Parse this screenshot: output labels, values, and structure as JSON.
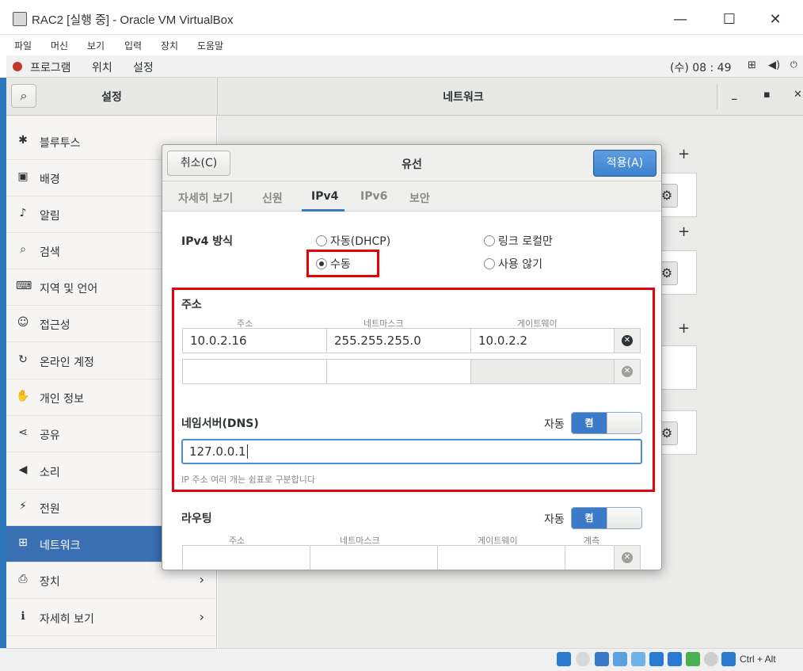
{
  "vbox": {
    "title": "RAC2 [실행 중] - Oracle VM VirtualBox",
    "menu": [
      "파일",
      "머신",
      "보기",
      "입력",
      "장치",
      "도움말"
    ],
    "host_key": "Ctrl + Alt"
  },
  "guest_topbar": {
    "apps": "프로그램",
    "places": "위치",
    "settings": "설정",
    "clock": "(수) 08 : 49"
  },
  "settings": {
    "title": "설정",
    "panel_title": "네트워크",
    "sidebar": [
      {
        "label": "블루투스",
        "icon": "bluetooth-icon",
        "glyph": "✱"
      },
      {
        "label": "배경",
        "icon": "background-icon",
        "glyph": "▣"
      },
      {
        "label": "알림",
        "icon": "bell-icon",
        "glyph": "♪"
      },
      {
        "label": "검색",
        "icon": "search-icon",
        "glyph": "⌕"
      },
      {
        "label": "지역 및 언어",
        "icon": "region-icon",
        "glyph": "⌨"
      },
      {
        "label": "접근성",
        "icon": "accessibility-icon",
        "glyph": "☺"
      },
      {
        "label": "온라인 계정",
        "icon": "online-accounts-icon",
        "glyph": "↻"
      },
      {
        "label": "개인 정보",
        "icon": "privacy-icon",
        "glyph": "✋"
      },
      {
        "label": "공유",
        "icon": "share-icon",
        "glyph": "⋖"
      },
      {
        "label": "소리",
        "icon": "sound-icon",
        "glyph": "◀"
      },
      {
        "label": "전원",
        "icon": "power-icon",
        "glyph": "⚡"
      },
      {
        "label": "네트워크",
        "icon": "network-icon",
        "glyph": "⊞"
      },
      {
        "label": "장치",
        "icon": "devices-icon",
        "glyph": "⎙"
      },
      {
        "label": "자세히 보기",
        "icon": "details-icon",
        "glyph": "ℹ"
      }
    ],
    "active_index": 11
  },
  "dialog": {
    "title": "유선",
    "cancel": "취소(C)",
    "apply": "적용(A)",
    "tabs": [
      "자세히 보기",
      "신원",
      "IPv4",
      "IPv6",
      "보안"
    ],
    "active_tab": "IPv4",
    "ipv4_method_label": "IPv4 방식",
    "methods": {
      "auto": "자동(DHCP)",
      "link_local": "링크 로컬만",
      "manual": "수동",
      "disabled": "사용 않기"
    },
    "selected_method": "manual",
    "address_section": {
      "title": "주소",
      "headers": [
        "주소",
        "네트마스크",
        "게이트웨이"
      ],
      "rows": [
        {
          "address": "10.0.2.16",
          "netmask": "255.255.255.0",
          "gateway": "10.0.2.2"
        },
        {
          "address": "",
          "netmask": "",
          "gateway": ""
        }
      ]
    },
    "dns": {
      "title": "네임서버(DNS)",
      "auto_label": "자동",
      "switch_on": "켬",
      "value": "127.0.0.1",
      "hint": "IP 주소 여러 개는 쉼표로 구분합니다"
    },
    "routing": {
      "title": "라우팅",
      "auto_label": "자동",
      "switch_on": "켬",
      "headers": [
        "주소",
        "네트마스크",
        "게이트웨이",
        "계측"
      ]
    }
  },
  "colors": {
    "accent": "#3b7ac8",
    "highlight": "#e8000b",
    "sidebar_active": "#3b6fb4"
  }
}
